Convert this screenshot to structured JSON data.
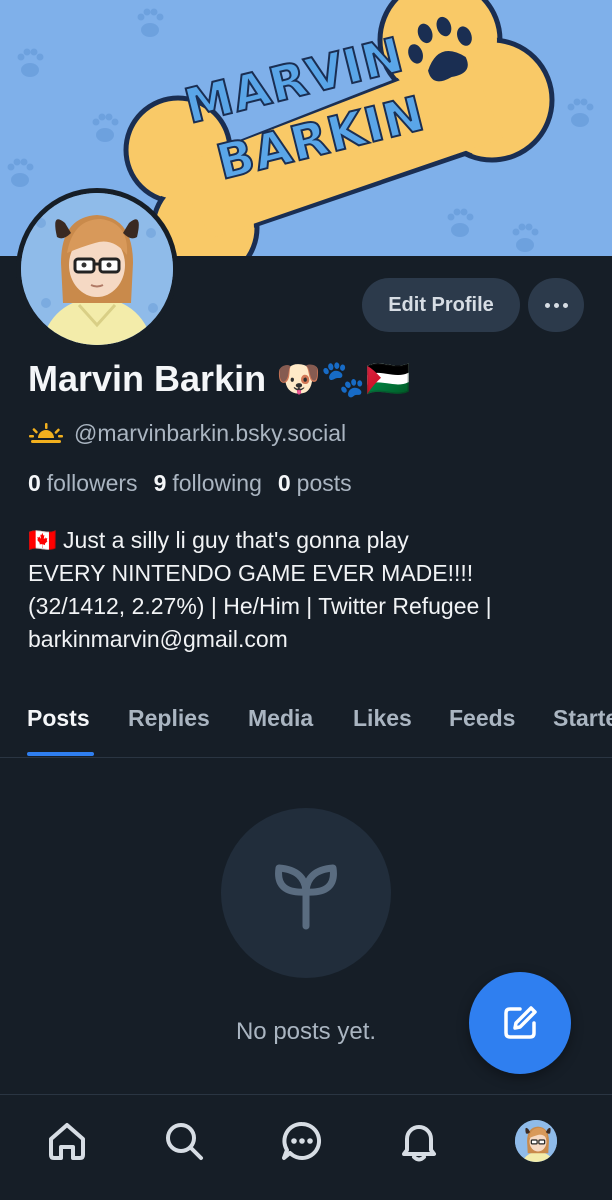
{
  "banner": {
    "line1": "MARVIN",
    "line2": "BARKIN",
    "bg_color": "#7fb0ea",
    "bone_color": "#f9c967"
  },
  "profile": {
    "name": "Marvin Barkin 🐶🐾🇵🇸",
    "handle": "@marvinbarkin.bsky.social",
    "handle_icon": "sunrise-icon",
    "edit_label": "Edit Profile",
    "more_icon": "ellipsis-icon"
  },
  "stats": {
    "followers_count": "0",
    "followers_label": "followers",
    "following_count": "9",
    "following_label": "following",
    "posts_count": "0",
    "posts_label": "posts"
  },
  "bio": {
    "line1": "🇨🇦 Just a silly li guy that's gonna play",
    "line2": "EVERY NINTENDO GAME EVER MADE!!!!",
    "line3": "(32/1412, 2.27%) | He/Him | Twitter Refugee |",
    "line4": "barkinmarvin@gmail.com"
  },
  "tabs": [
    {
      "label": "Posts",
      "active": true
    },
    {
      "label": "Replies",
      "active": false
    },
    {
      "label": "Media",
      "active": false
    },
    {
      "label": "Likes",
      "active": false
    },
    {
      "label": "Feeds",
      "active": false
    },
    {
      "label": "Starte",
      "active": false
    }
  ],
  "empty_state": {
    "icon": "sprout-icon",
    "text": "No posts yet."
  },
  "fab": {
    "icon": "compose-icon"
  },
  "bottom_nav": [
    {
      "icon": "home-icon"
    },
    {
      "icon": "search-icon"
    },
    {
      "icon": "chat-icon"
    },
    {
      "icon": "bell-icon"
    },
    {
      "icon": "avatar"
    }
  ],
  "colors": {
    "background": "#161e27",
    "accent": "#2f7ff0",
    "button_bg": "#2c3a4b",
    "muted_text": "#aab5c1"
  }
}
